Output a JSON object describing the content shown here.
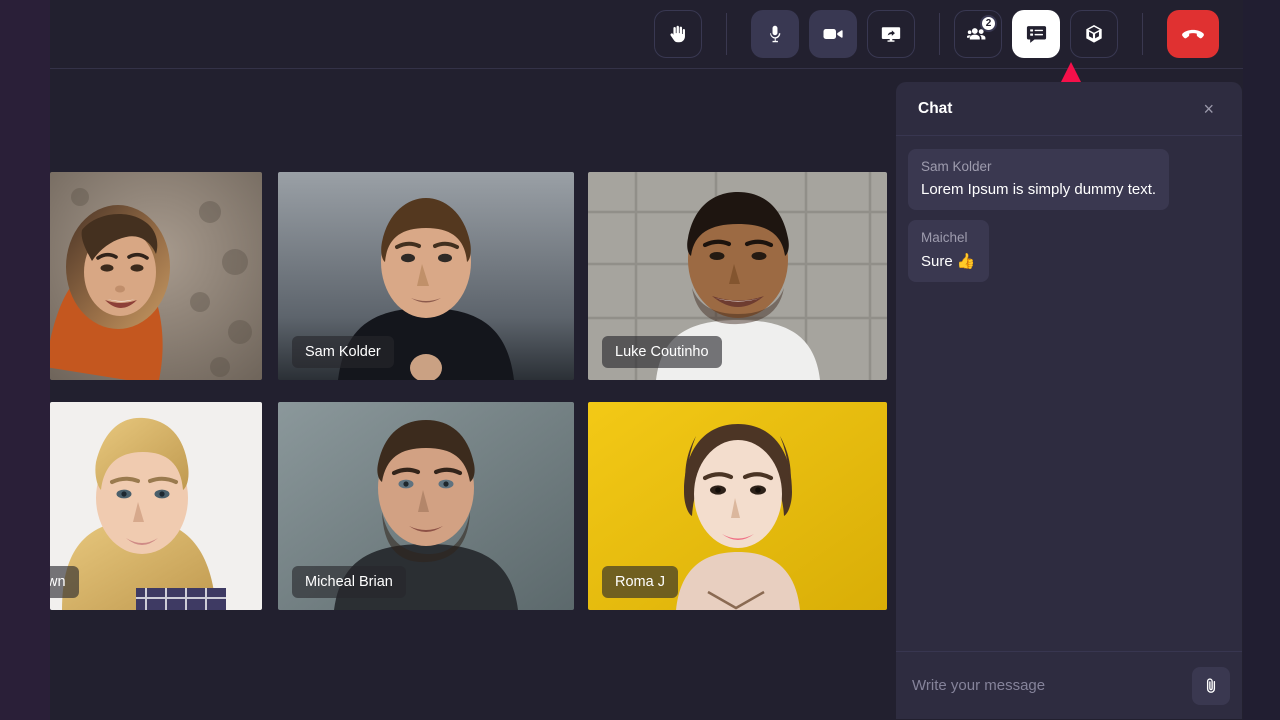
{
  "toolbar": {
    "buttons": [
      {
        "name": "raise-hand",
        "icon": "hand-icon",
        "label": "Raise hand",
        "style": "ghost",
        "badge": null
      },
      {
        "name": "microphone",
        "icon": "microphone-icon",
        "label": "Microphone",
        "style": "filled",
        "badge": null
      },
      {
        "name": "camera",
        "icon": "video-camera-icon",
        "label": "Camera",
        "style": "filled",
        "badge": null
      },
      {
        "name": "screen-share",
        "icon": "screen-share-icon",
        "label": "Share screen",
        "style": "ghost",
        "badge": null
      },
      {
        "name": "participants",
        "icon": "people-icon",
        "label": "Participants",
        "style": "ghost",
        "badge": "2"
      },
      {
        "name": "chat",
        "icon": "chat-list-icon",
        "label": "Chat",
        "style": "active",
        "badge": null
      },
      {
        "name": "apps",
        "icon": "cube-icon",
        "label": "Apps",
        "style": "ghost",
        "badge": null
      },
      {
        "name": "end-call",
        "icon": "hangup-phone-icon",
        "label": "End call",
        "style": "danger",
        "badge": null
      }
    ]
  },
  "grid": {
    "tiles": [
      {
        "name": "jessica",
        "label": "",
        "label_visible": false
      },
      {
        "name": "sam",
        "label": "Sam Kolder",
        "label_visible": true
      },
      {
        "name": "luke",
        "label": "Luke Coutinho",
        "label_visible": true
      },
      {
        "name": "brown",
        "label": "wn",
        "label_visible": true
      },
      {
        "name": "micheal",
        "label": "Micheal Brian",
        "label_visible": true
      },
      {
        "name": "roma",
        "label": "Roma J",
        "label_visible": true
      }
    ]
  },
  "chat": {
    "title": "Chat",
    "close_label": "×",
    "messages": [
      {
        "sender": "Sam Kolder",
        "text": "Lorem Ipsum is simply dummy text."
      },
      {
        "sender": "Maichel",
        "text": "Sure 👍"
      }
    ],
    "input_placeholder": "Write your message",
    "input_value": "",
    "attach_label": "Attach file"
  },
  "colors": {
    "background": "#2a1f38",
    "stage": "#22202f",
    "panel": "#2e2c40",
    "bubble": "#3a3850",
    "accent_danger": "#e03131",
    "annotation_arrow": "#f5104a"
  }
}
